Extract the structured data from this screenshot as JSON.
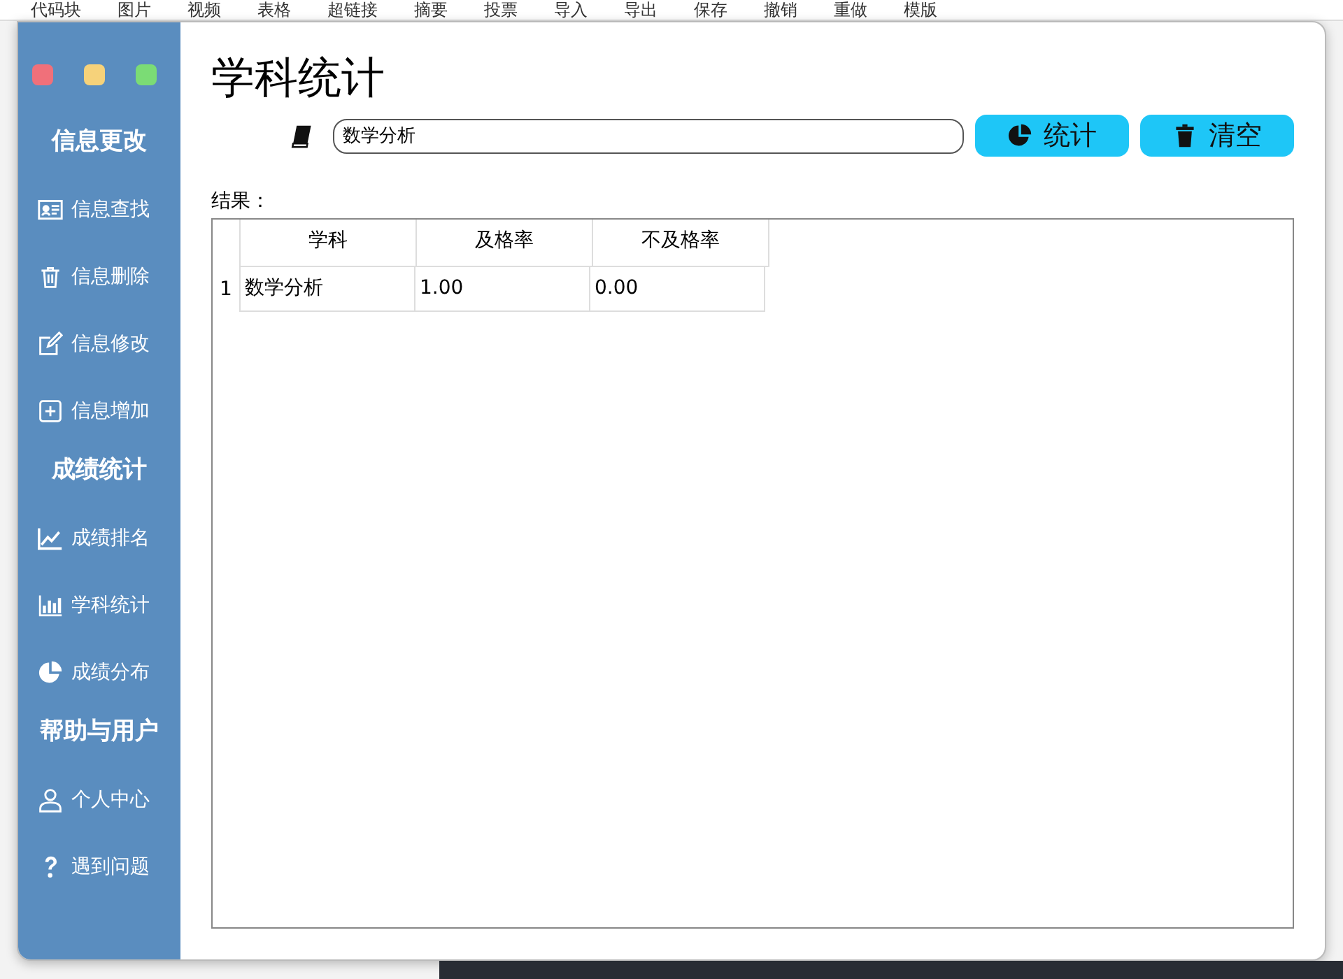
{
  "background_menu": [
    "代码块",
    "图片",
    "视频",
    "表格",
    "超链接",
    "摘要",
    "投票",
    "导入",
    "导出",
    "保存",
    "撤销",
    "重做",
    "模版"
  ],
  "sidebar": {
    "sections": [
      {
        "title": "信息更改",
        "items": [
          {
            "label": "信息查找"
          },
          {
            "label": "信息删除"
          },
          {
            "label": "信息修改"
          },
          {
            "label": "信息增加"
          }
        ]
      },
      {
        "title": "成绩统计",
        "items": [
          {
            "label": "成绩排名"
          },
          {
            "label": "学科统计"
          },
          {
            "label": "成绩分布"
          }
        ]
      },
      {
        "title": "帮助与用户",
        "items": [
          {
            "label": "个人中心"
          },
          {
            "label": "遇到问题"
          }
        ]
      }
    ]
  },
  "page": {
    "title": "学科统计",
    "subject_field": {
      "value": "数学分析"
    },
    "buttons": [
      {
        "label": "统计"
      },
      {
        "label": "清空"
      }
    ],
    "result_label": "结果：",
    "table": {
      "columns": [
        "学科",
        "及格率",
        "不及格率"
      ],
      "rows": [
        {
          "number": "1",
          "cells": [
            "数学分析",
            "1.00",
            "0.00"
          ]
        }
      ]
    }
  }
}
